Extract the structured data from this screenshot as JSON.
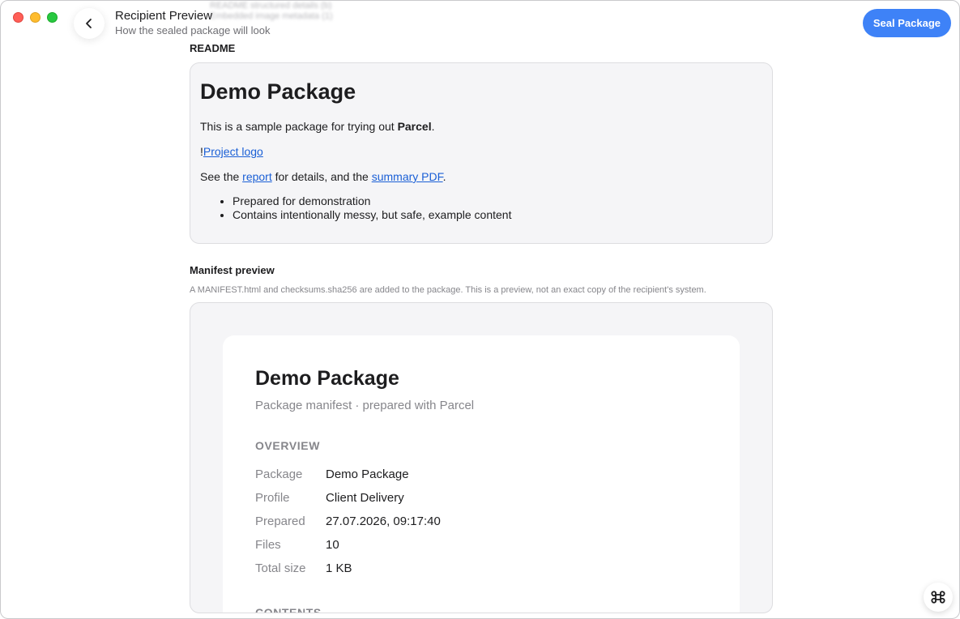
{
  "header": {
    "title": "Recipient Preview",
    "subtitle": "How the sealed package will look",
    "ghost_line_1": "README structured details (b)",
    "ghost_line_2": "Embedded image metadata (1)",
    "seal_label": "Seal Package"
  },
  "readme": {
    "label": "README",
    "heading": "Demo Package",
    "intro_prefix": "This is a sample package for trying out ",
    "intro_bold": "Parcel",
    "intro_suffix": ".",
    "image_bang": "!",
    "image_link": "Project logo",
    "details_prefix": "See the ",
    "report_link": "report",
    "details_middle": " for details, and the ",
    "summary_link": "summary PDF",
    "details_suffix": ".",
    "bullets": [
      "Prepared for demonstration",
      "Contains intentionally messy, but safe, example content"
    ]
  },
  "manifest": {
    "label": "Manifest preview",
    "note": "A MANIFEST.html and checksums.sha256 are added to the package. This is a preview, not an exact copy of the recipient's system.",
    "doc": {
      "title": "Demo Package",
      "subtitle": "Package manifest · prepared with Parcel",
      "overview_heading": "OVERVIEW",
      "rows": [
        {
          "key": "Package",
          "value": "Demo Package"
        },
        {
          "key": "Profile",
          "value": "Client Delivery"
        },
        {
          "key": "Prepared",
          "value": "27.07.2026, 09:17:40"
        },
        {
          "key": "Files",
          "value": "10"
        },
        {
          "key": "Total size",
          "value": "1 KB"
        }
      ],
      "contents_heading": "CONTENTS"
    }
  },
  "icons": {
    "back": "chevron-left-icon",
    "corner": "command-icon"
  },
  "colors": {
    "accent": "#3e82f7",
    "link": "#1a5fd6"
  }
}
